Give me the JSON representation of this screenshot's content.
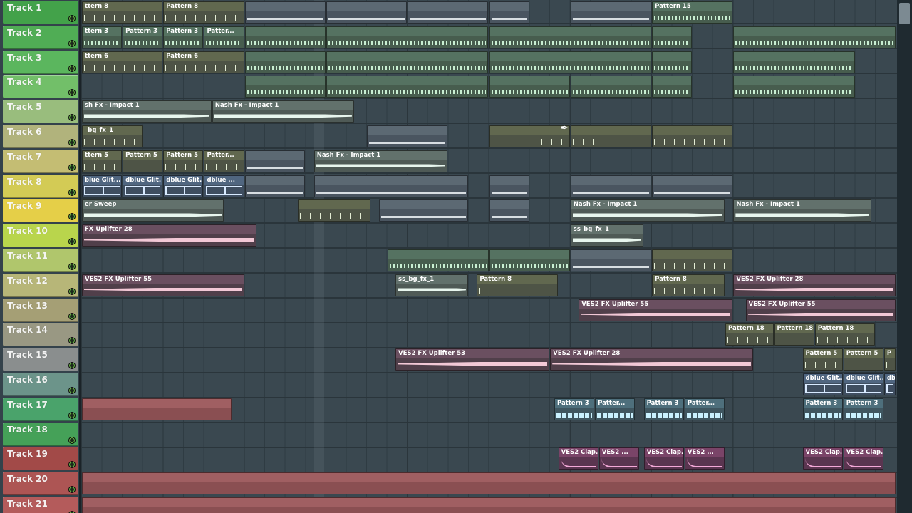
{
  "tracks": [
    {
      "name": "Track 1",
      "color": "#43a24a"
    },
    {
      "name": "Track 2",
      "color": "#50ad55"
    },
    {
      "name": "Track 3",
      "color": "#5bb65e"
    },
    {
      "name": "Track 4",
      "color": "#72bf69"
    },
    {
      "name": "Track 5",
      "color": "#99bd7d"
    },
    {
      "name": "Track 6",
      "color": "#b1b37c"
    },
    {
      "name": "Track 7",
      "color": "#c4bd73"
    },
    {
      "name": "Track 8",
      "color": "#d3cb55"
    },
    {
      "name": "Track 9",
      "color": "#e5cf48"
    },
    {
      "name": "Track 10",
      "color": "#b9d54c"
    },
    {
      "name": "Track 11",
      "color": "#b0c66c"
    },
    {
      "name": "Track 12",
      "color": "#b7b678"
    },
    {
      "name": "Track 13",
      "color": "#a59f75"
    },
    {
      "name": "Track 14",
      "color": "#999883"
    },
    {
      "name": "Track 15",
      "color": "#8a8e8e"
    },
    {
      "name": "Track 16",
      "color": "#6c948a"
    },
    {
      "name": "Track 17",
      "color": "#4aa36b"
    },
    {
      "name": "Track 18",
      "color": "#45a158"
    },
    {
      "name": "Track 19",
      "color": "#a24a48"
    },
    {
      "name": "Track 20",
      "color": "#ad5554"
    },
    {
      "name": "Track 21",
      "color": "#b45b5b"
    }
  ],
  "clips": [
    {
      "track": 0,
      "start": 0,
      "end": 2,
      "label": "ttern 8",
      "style": "c-olive"
    },
    {
      "track": 0,
      "start": 2,
      "end": 4,
      "label": "Pattern 8",
      "style": "c-olive"
    },
    {
      "track": 0,
      "start": 4,
      "end": 6,
      "label": "",
      "style": "c-gray"
    },
    {
      "track": 0,
      "start": 6,
      "end": 8,
      "label": "",
      "style": "c-gray"
    },
    {
      "track": 0,
      "start": 8,
      "end": 10,
      "label": "",
      "style": "c-gray"
    },
    {
      "track": 0,
      "start": 10,
      "end": 11,
      "label": "",
      "style": "c-gray"
    },
    {
      "track": 0,
      "start": 12,
      "end": 14,
      "label": "",
      "style": "c-gray"
    },
    {
      "track": 0,
      "start": 14,
      "end": 16,
      "label": "Pattern 15",
      "style": "c-green"
    },
    {
      "track": 1,
      "start": 0,
      "end": 1,
      "label": "ttern 3",
      "style": "c-green"
    },
    {
      "track": 1,
      "start": 1,
      "end": 2,
      "label": "Pattern 3",
      "style": "c-green"
    },
    {
      "track": 1,
      "start": 2,
      "end": 3,
      "label": "Pattern 3",
      "style": "c-green"
    },
    {
      "track": 1,
      "start": 3,
      "end": 4,
      "label": "Patter...",
      "style": "c-green"
    },
    {
      "track": 1,
      "start": 4,
      "end": 6,
      "label": "",
      "style": "c-green"
    },
    {
      "track": 1,
      "start": 6,
      "end": 10,
      "label": "",
      "style": "c-green"
    },
    {
      "track": 1,
      "start": 10,
      "end": 14,
      "label": "",
      "style": "c-green"
    },
    {
      "track": 1,
      "start": 14,
      "end": 15,
      "label": "",
      "style": "c-green"
    },
    {
      "track": 1,
      "start": 16,
      "end": 20,
      "label": "",
      "style": "c-green"
    },
    {
      "track": 2,
      "start": 0,
      "end": 2,
      "label": "ttern 6",
      "style": "c-olive"
    },
    {
      "track": 2,
      "start": 2,
      "end": 4,
      "label": "Pattern 6",
      "style": "c-olive"
    },
    {
      "track": 2,
      "start": 4,
      "end": 6,
      "label": "",
      "style": "c-green"
    },
    {
      "track": 2,
      "start": 6,
      "end": 10,
      "label": "",
      "style": "c-green"
    },
    {
      "track": 2,
      "start": 10,
      "end": 14,
      "label": "",
      "style": "c-green"
    },
    {
      "track": 2,
      "start": 14,
      "end": 15,
      "label": "",
      "style": "c-green"
    },
    {
      "track": 2,
      "start": 16,
      "end": 19,
      "label": "",
      "style": "c-green"
    },
    {
      "track": 3,
      "start": 4,
      "end": 6,
      "label": "",
      "style": "c-green"
    },
    {
      "track": 3,
      "start": 6,
      "end": 10,
      "label": "",
      "style": "c-green"
    },
    {
      "track": 3,
      "start": 10,
      "end": 12,
      "label": "",
      "style": "c-green"
    },
    {
      "track": 3,
      "start": 12,
      "end": 14,
      "label": "",
      "style": "c-green"
    },
    {
      "track": 3,
      "start": 14,
      "end": 15,
      "label": "",
      "style": "c-green"
    },
    {
      "track": 3,
      "start": 16,
      "end": 19,
      "label": "",
      "style": "c-green"
    },
    {
      "track": 4,
      "start": 0,
      "end": 3.2,
      "label": "sh Fx - Impact 1",
      "style": "c-audio"
    },
    {
      "track": 4,
      "start": 3.2,
      "end": 6.7,
      "label": "Nash Fx - Impact 1",
      "style": "c-audio"
    },
    {
      "track": 5,
      "start": 0,
      "end": 1.5,
      "label": "_bg_fx_1",
      "style": "c-olive"
    },
    {
      "track": 5,
      "start": 7,
      "end": 9,
      "label": "",
      "style": "c-gray"
    },
    {
      "track": 5,
      "start": 10,
      "end": 12,
      "label": "",
      "style": "c-olive"
    },
    {
      "track": 5,
      "start": 12,
      "end": 14,
      "label": "",
      "style": "c-olive"
    },
    {
      "track": 5,
      "start": 14,
      "end": 16,
      "label": "",
      "style": "c-olive"
    },
    {
      "track": 6,
      "start": 0,
      "end": 1,
      "label": "ttern 5",
      "style": "c-olive"
    },
    {
      "track": 6,
      "start": 1,
      "end": 2,
      "label": "Pattern 5",
      "style": "c-olive"
    },
    {
      "track": 6,
      "start": 2,
      "end": 3,
      "label": "Pattern 5",
      "style": "c-olive"
    },
    {
      "track": 6,
      "start": 3,
      "end": 4,
      "label": "Patter...",
      "style": "c-olive"
    },
    {
      "track": 6,
      "start": 4,
      "end": 5.5,
      "label": "",
      "style": "c-gray"
    },
    {
      "track": 6,
      "start": 5.7,
      "end": 9,
      "label": "Nash Fx - Impact 1",
      "style": "c-audio"
    },
    {
      "track": 7,
      "start": 0,
      "end": 1,
      "label": "blue Glit...",
      "style": "c-blue"
    },
    {
      "track": 7,
      "start": 1,
      "end": 2,
      "label": "dblue Glit...",
      "style": "c-blue"
    },
    {
      "track": 7,
      "start": 2,
      "end": 3,
      "label": "dblue Glit...",
      "style": "c-blue"
    },
    {
      "track": 7,
      "start": 3,
      "end": 4,
      "label": "dblue ...",
      "style": "c-blue"
    },
    {
      "track": 7,
      "start": 4,
      "end": 5.5,
      "label": "",
      "style": "c-gray"
    },
    {
      "track": 7,
      "start": 5.7,
      "end": 9.5,
      "label": "",
      "style": "c-gray"
    },
    {
      "track": 7,
      "start": 10,
      "end": 11,
      "label": "",
      "style": "c-gray"
    },
    {
      "track": 7,
      "start": 12,
      "end": 14,
      "label": "",
      "style": "c-gray"
    },
    {
      "track": 7,
      "start": 14,
      "end": 16,
      "label": "",
      "style": "c-gray"
    },
    {
      "track": 8,
      "start": 0,
      "end": 3.5,
      "label": "er Sweep",
      "style": "c-audio"
    },
    {
      "track": 8,
      "start": 5.3,
      "end": 7.1,
      "label": "",
      "style": "c-olive"
    },
    {
      "track": 8,
      "start": 7.3,
      "end": 9.5,
      "label": "",
      "style": "c-gray"
    },
    {
      "track": 8,
      "start": 10,
      "end": 11,
      "label": "",
      "style": "c-gray"
    },
    {
      "track": 8,
      "start": 12,
      "end": 15.8,
      "label": "Nash Fx - Impact 1",
      "style": "c-audio"
    },
    {
      "track": 8,
      "start": 16,
      "end": 19.4,
      "label": "Nash Fx - Impact 1",
      "style": "c-audio"
    },
    {
      "track": 9,
      "start": 0,
      "end": 4.3,
      "label": "FX Uplifter 28",
      "style": "c-pink"
    },
    {
      "track": 9,
      "start": 12,
      "end": 13.8,
      "label": "ss_bg_fx_1",
      "style": "c-audio"
    },
    {
      "track": 10,
      "start": 7.5,
      "end": 10,
      "label": "",
      "style": "c-green"
    },
    {
      "track": 10,
      "start": 10,
      "end": 12,
      "label": "",
      "style": "c-green"
    },
    {
      "track": 10,
      "start": 12,
      "end": 14,
      "label": "",
      "style": "c-gray"
    },
    {
      "track": 10,
      "start": 14,
      "end": 16,
      "label": "",
      "style": "c-olive"
    },
    {
      "track": 11,
      "start": 0,
      "end": 4,
      "label": "VES2 FX Uplifter 55",
      "style": "c-pink"
    },
    {
      "track": 11,
      "start": 7.7,
      "end": 9.5,
      "label": "ss_bg_fx_1",
      "style": "c-audio"
    },
    {
      "track": 11,
      "start": 9.7,
      "end": 11.7,
      "label": "Pattern 8",
      "style": "c-olive"
    },
    {
      "track": 11,
      "start": 14,
      "end": 15.8,
      "label": "Pattern 8",
      "style": "c-olive"
    },
    {
      "track": 11,
      "start": 16,
      "end": 20,
      "label": "VES2 FX Uplifter 28",
      "style": "c-pink"
    },
    {
      "track": 12,
      "start": 12.2,
      "end": 16,
      "label": "VES2 FX Uplifter 55",
      "style": "c-pink"
    },
    {
      "track": 12,
      "start": 16.3,
      "end": 20,
      "label": "VES2 FX Uplifter 55",
      "style": "c-pink"
    },
    {
      "track": 13,
      "start": 15.8,
      "end": 17,
      "label": "Pattern 18",
      "style": "c-olive"
    },
    {
      "track": 13,
      "start": 17,
      "end": 18,
      "label": "Pattern 18",
      "style": "c-olive"
    },
    {
      "track": 13,
      "start": 18,
      "end": 19.5,
      "label": "Pattern 18",
      "style": "c-olive"
    },
    {
      "track": 14,
      "start": 7.7,
      "end": 11.5,
      "label": "VES2 FX Uplifter 53",
      "style": "c-pink"
    },
    {
      "track": 14,
      "start": 11.5,
      "end": 16.5,
      "label": "VES2 FX Uplifter 28",
      "style": "c-pink"
    },
    {
      "track": 14,
      "start": 17.7,
      "end": 18.7,
      "label": "Pattern 5",
      "style": "c-olive"
    },
    {
      "track": 14,
      "start": 18.7,
      "end": 19.7,
      "label": "Pattern 5",
      "style": "c-olive"
    },
    {
      "track": 14,
      "start": 19.7,
      "end": 20,
      "label": "P",
      "style": "c-olive"
    },
    {
      "track": 15,
      "start": 17.7,
      "end": 18.7,
      "label": "dblue Glit...",
      "style": "c-blue"
    },
    {
      "track": 15,
      "start": 18.7,
      "end": 19.7,
      "label": "dblue Glit...",
      "style": "c-blue"
    },
    {
      "track": 15,
      "start": 19.7,
      "end": 20,
      "label": "db",
      "style": "c-blue"
    },
    {
      "track": 16,
      "start": 0,
      "end": 3.7,
      "label": "",
      "style": "c-red"
    },
    {
      "track": 16,
      "start": 11.6,
      "end": 12.6,
      "label": "Pattern 3",
      "style": "c-cyan"
    },
    {
      "track": 16,
      "start": 12.6,
      "end": 13.6,
      "label": "Patter...",
      "style": "c-cyan"
    },
    {
      "track": 16,
      "start": 13.8,
      "end": 14.8,
      "label": "Pattern 3",
      "style": "c-cyan"
    },
    {
      "track": 16,
      "start": 14.8,
      "end": 15.8,
      "label": "Patter...",
      "style": "c-cyan"
    },
    {
      "track": 16,
      "start": 17.7,
      "end": 18.7,
      "label": "Pattern 3",
      "style": "c-cyan"
    },
    {
      "track": 16,
      "start": 18.7,
      "end": 19.7,
      "label": "Pattern 3",
      "style": "c-cyan"
    },
    {
      "track": 18,
      "start": 11.7,
      "end": 12.7,
      "label": "VES2 Clap...",
      "style": "c-magenta"
    },
    {
      "track": 18,
      "start": 12.7,
      "end": 13.7,
      "label": "VES2 ...",
      "style": "c-magenta"
    },
    {
      "track": 18,
      "start": 13.8,
      "end": 14.8,
      "label": "VES2 Clap...",
      "style": "c-magenta"
    },
    {
      "track": 18,
      "start": 14.8,
      "end": 15.8,
      "label": "VES2 ...",
      "style": "c-magenta"
    },
    {
      "track": 18,
      "start": 17.7,
      "end": 18.7,
      "label": "VES2 Clap...",
      "style": "c-magenta"
    },
    {
      "track": 18,
      "start": 18.7,
      "end": 19.7,
      "label": "VES2 Clap...",
      "style": "c-magenta"
    },
    {
      "track": 19,
      "start": 0,
      "end": 20,
      "label": "",
      "style": "c-red"
    },
    {
      "track": 20,
      "start": 0,
      "end": 20,
      "label": "",
      "style": "c-red"
    }
  ],
  "icons": {
    "cursor": "✒",
    "scroll_thumb": ""
  }
}
